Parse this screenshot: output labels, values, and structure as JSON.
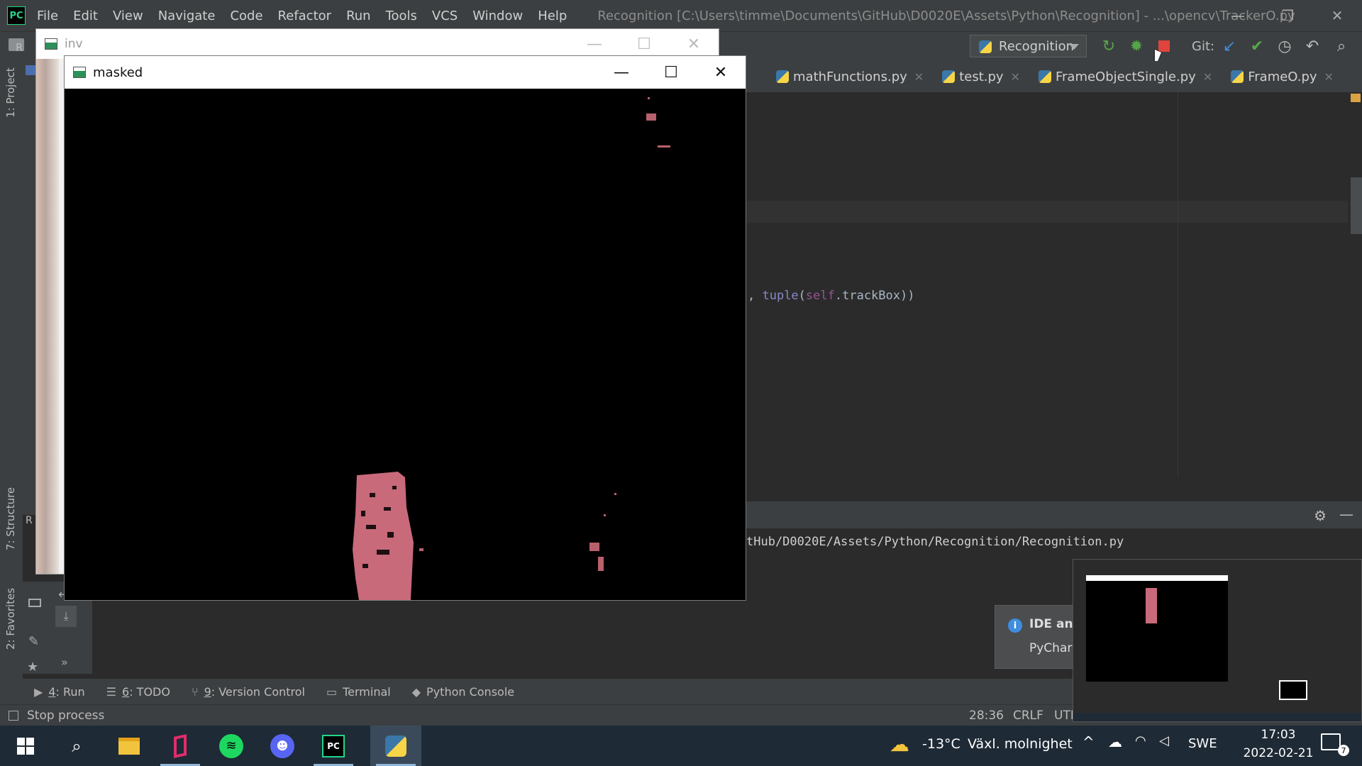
{
  "ide": {
    "menu": [
      "File",
      "Edit",
      "View",
      "Navigate",
      "Code",
      "Refactor",
      "Run",
      "Tools",
      "VCS",
      "Window",
      "Help"
    ],
    "title": "Recognition [C:\\Users\\timme\\Documents\\GitHub\\D0020E\\Assets\\Python\\Recognition] - ...\\opencv\\TrackerO.py",
    "run_config": "Recognition",
    "git_label": "Git:",
    "project_tab": "1: Project",
    "project_header_letter": "R",
    "structure_tab": "7: Structure",
    "favorites_tab": "2: Favorites",
    "run_panel_letter": "R",
    "tabs": [
      {
        "label": "mathFunctions.py"
      },
      {
        "label": "test.py"
      },
      {
        "label": "FrameObjectSingle.py"
      },
      {
        "label": "FrameO.py"
      }
    ],
    "code_line": ", tuple(self.trackBox))",
    "code_parts": {
      "pre": ", ",
      "fn": "tuple",
      "paren": "(",
      "self": "self",
      "rest": ".trackBox))"
    },
    "run_output": "tHub/D0020E/Assets/Python/Recognition/Recognition.py",
    "notification": {
      "title": "IDE and",
      "body": "PyCharm"
    },
    "bottom_tabs": [
      {
        "num": "4",
        "label": ": Run"
      },
      {
        "num": "6",
        "label": ": TODO"
      },
      {
        "num": "9",
        "label": ": Version Control"
      },
      {
        "num": "",
        "label": "Terminal"
      },
      {
        "num": "",
        "label": "Python Console"
      }
    ],
    "status": {
      "left": "Stop process",
      "pos": "28:36",
      "eol": "CRLF",
      "enc": "UTF"
    }
  },
  "windows": {
    "inv": {
      "title": "inv"
    },
    "masked": {
      "title": "masked"
    }
  },
  "taskbar": {
    "weather_temp": "-13°C",
    "weather_text": "Växl. molnighet",
    "lang": "SWE",
    "time": "17:03",
    "date": "2022-02-21",
    "notif_count": "7"
  },
  "colors": {
    "accent_green": "#21d789",
    "stop_red": "#e0443e",
    "mask_pink": "#c86a7a"
  }
}
